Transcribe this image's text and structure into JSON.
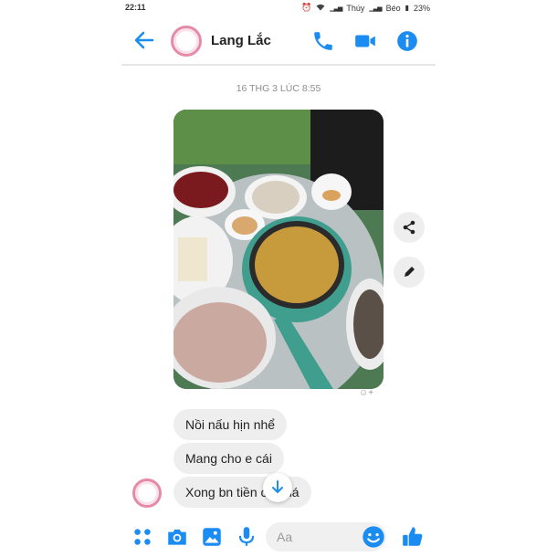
{
  "status_bar": {
    "time": "22:11",
    "carrier1": "Thúy",
    "carrier2": "Béo",
    "battery": "23%"
  },
  "header": {
    "contact_name": "Lang Lắc",
    "icons": [
      "back-arrow-icon",
      "phone-icon",
      "video-camera-icon",
      "info-icon"
    ]
  },
  "chat": {
    "timestamp": "16 THG 3 LÚC 8:55",
    "messages": [
      {
        "text": "Nồi nấu hịn nhể"
      },
      {
        "text": "Mang cho e cái"
      },
      {
        "text": "Xong bn tiền     cả nhá"
      }
    ]
  },
  "composer": {
    "placeholder": "Aa",
    "icons": [
      "apps-icon",
      "camera-icon",
      "gallery-icon",
      "microphone-icon",
      "emoji-icon",
      "thumbs-up-icon"
    ]
  },
  "colors": {
    "accent": "#1a8cf2",
    "bubble": "#eeeeee",
    "divider": "#e6e6e6"
  }
}
